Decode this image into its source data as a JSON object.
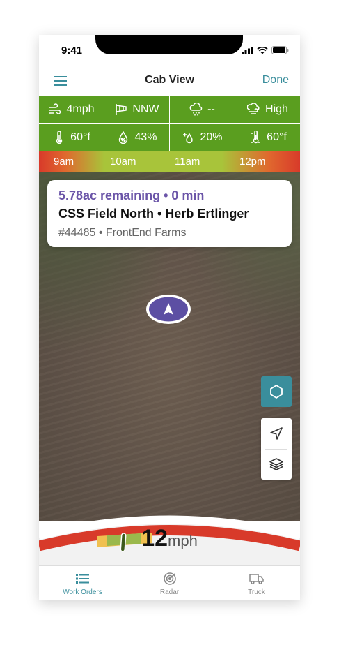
{
  "status_bar": {
    "time": "9:41"
  },
  "nav": {
    "title": "Cab View",
    "done_label": "Done"
  },
  "weather": {
    "row1": [
      {
        "icon": "wind-icon",
        "value": "4mph"
      },
      {
        "icon": "windsock-icon",
        "value": "NNW"
      },
      {
        "icon": "rain-cloud-icon",
        "value": "--"
      },
      {
        "icon": "gust-cloud-icon",
        "value": "High"
      }
    ],
    "row2": [
      {
        "icon": "thermometer-icon",
        "value": "60°f"
      },
      {
        "icon": "humidity-drop-icon",
        "value": "43%"
      },
      {
        "icon": "dew-drop-icon",
        "value": "20%"
      },
      {
        "icon": "soil-temp-icon",
        "value": "60°f"
      }
    ]
  },
  "timeline": {
    "labels": [
      "9am",
      "10am",
      "11am",
      "12pm"
    ]
  },
  "field_card": {
    "remaining": "5.78ac remaining • 0 min",
    "field": "CSS Field North • Herb Ertlinger",
    "order": "#44485 • FrontEnd Farms"
  },
  "map_controls": {
    "icons": [
      "geofence-icon",
      "navigate-icon",
      "layers-icon"
    ]
  },
  "speed": {
    "value": "12",
    "unit": "mph"
  },
  "tabs": [
    {
      "label": "Work Orders",
      "icon": "list-icon",
      "active": true
    },
    {
      "label": "Radar",
      "icon": "radar-icon",
      "active": false
    },
    {
      "label": "Truck",
      "icon": "truck-icon",
      "active": false
    }
  ],
  "colors": {
    "accent": "#3a8e9c",
    "weather_green": "#5a9e1f",
    "purple": "#6b55a8",
    "red": "#d83a2a"
  }
}
